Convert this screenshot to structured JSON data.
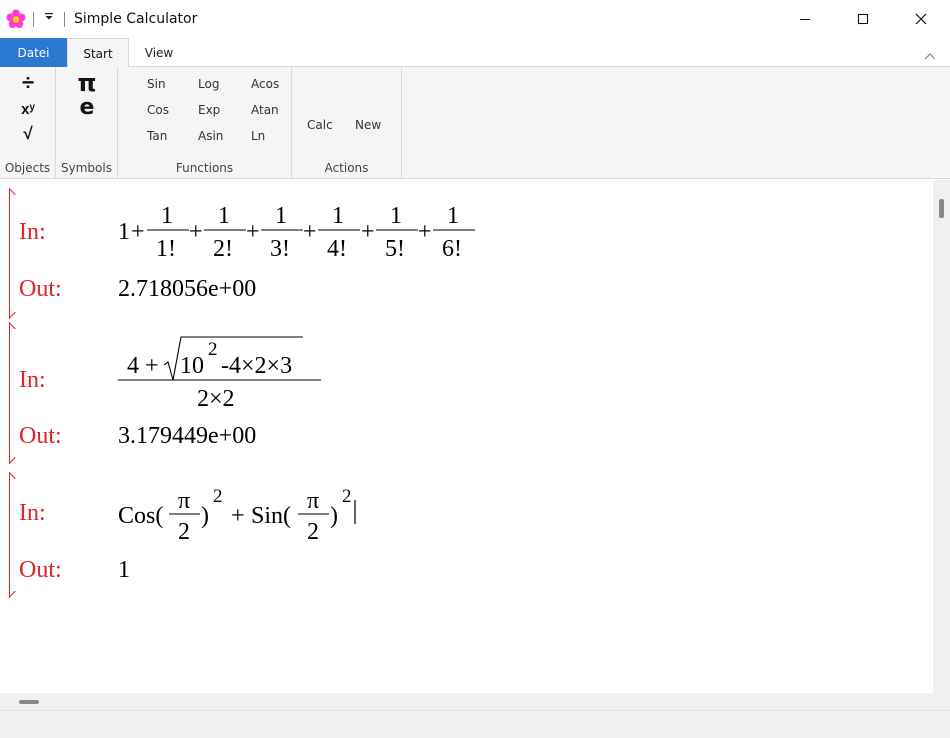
{
  "window": {
    "title": "Simple Calculator",
    "icon": "flower-icon",
    "controls": [
      "minimize-icon",
      "maximize-icon",
      "close-icon"
    ]
  },
  "ribbon": {
    "tabs": [
      {
        "label": "Datei",
        "active": false
      },
      {
        "label": "Start",
        "active": true
      },
      {
        "label": "View",
        "active": false
      }
    ],
    "groups": {
      "objects": {
        "label": "Objects",
        "buttons": [
          {
            "symbol": "÷",
            "icon": "divide-icon"
          },
          {
            "symbol": "xʸ",
            "icon": "power-icon"
          },
          {
            "symbol": "√",
            "icon": "sqrt-icon"
          }
        ]
      },
      "symbols": {
        "label": "Symbols",
        "buttons": [
          {
            "symbol": "π",
            "icon": "pi-icon"
          },
          {
            "symbol": "e",
            "icon": "e-icon"
          }
        ]
      },
      "functions": {
        "label": "Functions",
        "buttons": [
          "Sin",
          "Cos",
          "Tan",
          "Log",
          "Exp",
          "Asin",
          "Acos",
          "Atan",
          "Ln"
        ]
      },
      "actions": {
        "label": "Actions",
        "buttons": [
          "Calc",
          "New"
        ]
      }
    }
  },
  "document": {
    "cells": [
      {
        "in_label": "In:",
        "out_label": "Out:",
        "expression": {
          "lead": "1",
          "op": "+",
          "numerator": "1",
          "denominators": [
            "1!",
            "2!",
            "3!",
            "4!",
            "5!",
            "6!"
          ]
        },
        "output": "2.718056e+00"
      },
      {
        "in_label": "In:",
        "out_label": "Out:",
        "expression": {
          "lead": "4 +",
          "radicand_base": "10",
          "radicand_exp": "2",
          "radicand_rest": "-4×2×3",
          "denominator": "2×2"
        },
        "output": "3.179449e+00"
      },
      {
        "in_label": "In:",
        "out_label": "Out:",
        "expression": {
          "f1": "Cos(",
          "f2": "Sin(",
          "numerator": "π",
          "denominator": "2",
          "close": ")",
          "exp": "2",
          "plus": "+"
        },
        "output": "1"
      }
    ]
  },
  "colors": {
    "accent": "#2b79d0",
    "label_red": "#e0242a",
    "ribbon_bg": "#f5f5f5"
  }
}
